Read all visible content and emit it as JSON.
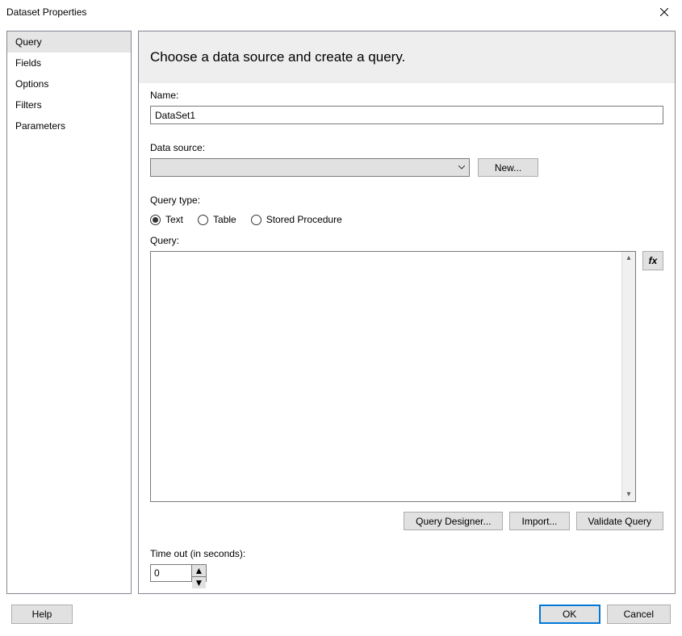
{
  "window": {
    "title": "Dataset Properties"
  },
  "sidebar": {
    "items": [
      {
        "label": "Query",
        "selected": true
      },
      {
        "label": "Fields"
      },
      {
        "label": "Options"
      },
      {
        "label": "Filters"
      },
      {
        "label": "Parameters"
      }
    ]
  },
  "main": {
    "heading": "Choose a data source and create a query.",
    "name_label": "Name:",
    "name_value": "DataSet1",
    "datasource_label": "Data source:",
    "datasource_value": "",
    "new_button": "New...",
    "querytype_label": "Query type:",
    "querytype_options": [
      {
        "label": "Text",
        "selected": true
      },
      {
        "label": "Table",
        "selected": false
      },
      {
        "label": "Stored Procedure",
        "selected": false
      }
    ],
    "query_label": "Query:",
    "query_value": "",
    "fx_label": "fx",
    "buttons": {
      "designer": "Query Designer...",
      "import": "Import...",
      "validate": "Validate Query"
    },
    "timeout_label": "Time out (in seconds):",
    "timeout_value": "0"
  },
  "footer": {
    "help": "Help",
    "ok": "OK",
    "cancel": "Cancel"
  }
}
